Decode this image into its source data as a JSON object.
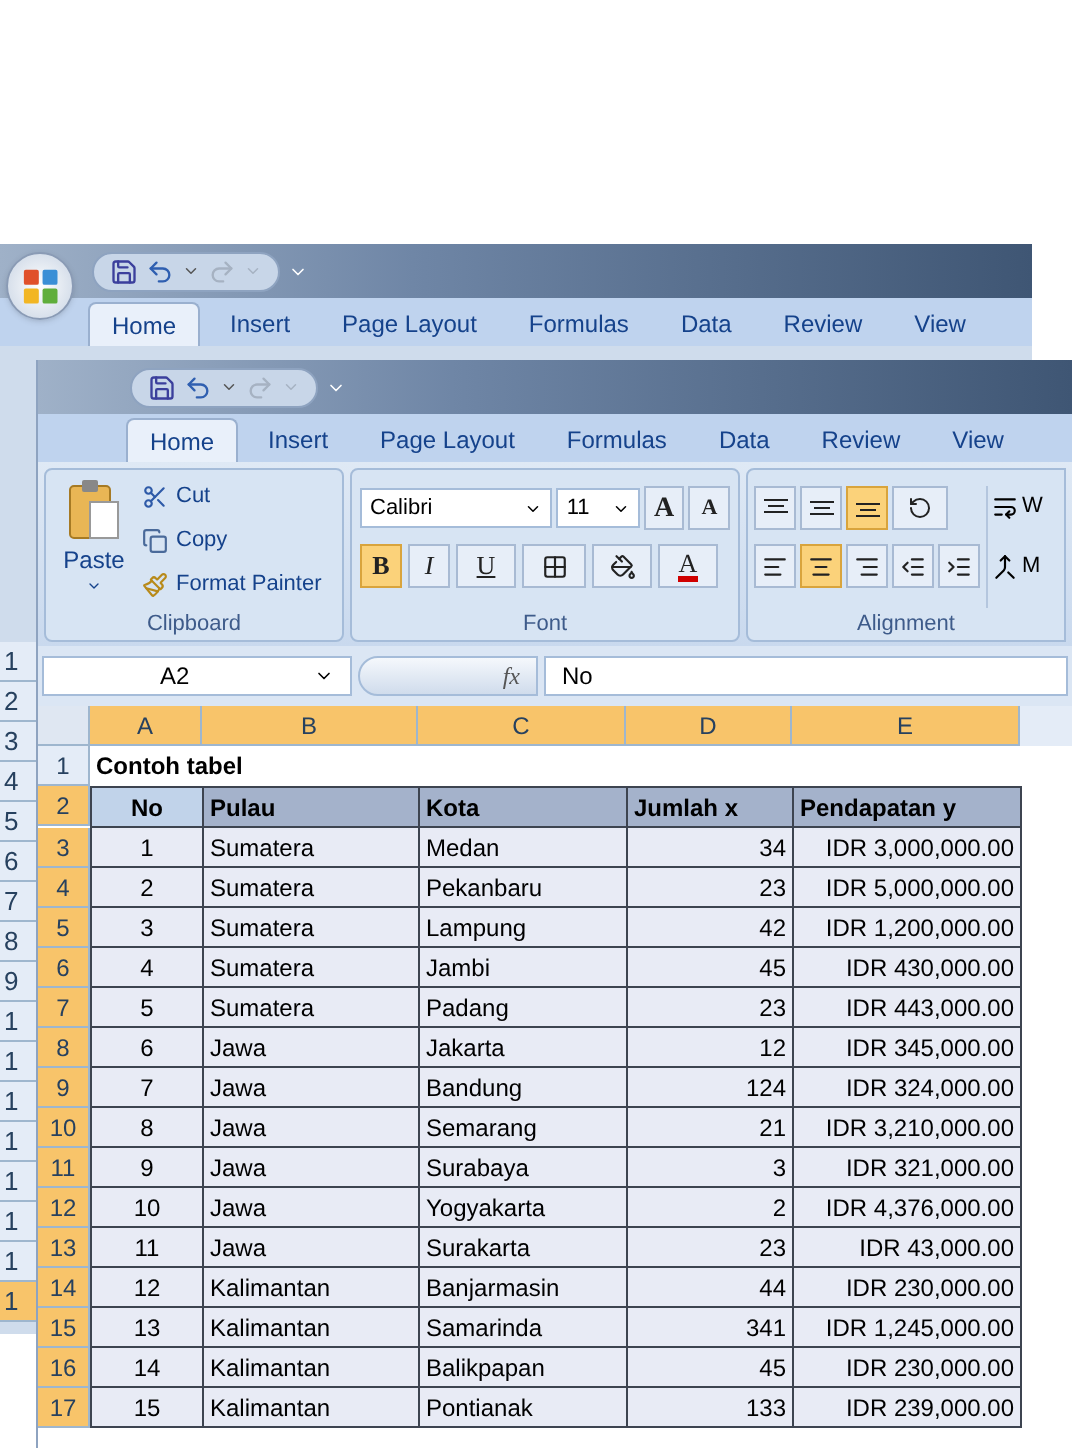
{
  "back_window": {
    "tabs": [
      {
        "label": "Home",
        "selected": true
      },
      {
        "label": "Insert",
        "selected": false
      },
      {
        "label": "Page Layout",
        "selected": false
      },
      {
        "label": "Formulas",
        "selected": false
      },
      {
        "label": "Data",
        "selected": false
      },
      {
        "label": "Review",
        "selected": false
      },
      {
        "label": "View",
        "selected": false
      }
    ],
    "row_numbers": [
      {
        "label": "1",
        "selected": false
      },
      {
        "label": "2",
        "selected": false
      },
      {
        "label": "3",
        "selected": false
      },
      {
        "label": "4",
        "selected": false
      },
      {
        "label": "5",
        "selected": false
      },
      {
        "label": "6",
        "selected": false
      },
      {
        "label": "7",
        "selected": false
      },
      {
        "label": "8",
        "selected": false
      },
      {
        "label": "9",
        "selected": false
      },
      {
        "label": "1",
        "selected": false
      },
      {
        "label": "1",
        "selected": false
      },
      {
        "label": "1",
        "selected": false
      },
      {
        "label": "1",
        "selected": false
      },
      {
        "label": "1",
        "selected": false
      },
      {
        "label": "1",
        "selected": false
      },
      {
        "label": "1",
        "selected": false
      },
      {
        "label": "1",
        "selected": true
      }
    ]
  },
  "window": {
    "tabs": [
      {
        "label": "Home",
        "selected": true
      },
      {
        "label": "Insert",
        "selected": false
      },
      {
        "label": "Page Layout",
        "selected": false
      },
      {
        "label": "Formulas",
        "selected": false
      },
      {
        "label": "Data",
        "selected": false
      },
      {
        "label": "Review",
        "selected": false
      },
      {
        "label": "View",
        "selected": false
      }
    ],
    "clipboard": {
      "paste": "Paste",
      "items": [
        {
          "kind": "cut",
          "label": "Cut"
        },
        {
          "kind": "copy",
          "label": "Copy"
        },
        {
          "kind": "painter",
          "label": "Format Painter"
        }
      ],
      "title": "Clipboard"
    },
    "font": {
      "name": "Calibri",
      "size": "11",
      "grow": "A",
      "shrink": "A",
      "bold": {
        "label": "B",
        "on": true
      },
      "italic": {
        "label": "I",
        "on": false
      },
      "underline": {
        "label": "U",
        "on": false
      },
      "color_letter": "A",
      "title": "Font"
    },
    "alignment": {
      "vertical": [
        {
          "selected": false
        },
        {
          "selected": false
        },
        {
          "selected": true
        }
      ],
      "horizontal": [
        {
          "selected": false
        },
        {
          "selected": true
        },
        {
          "selected": false
        }
      ],
      "wrap": "W",
      "merge": "M",
      "title": "Alignment"
    },
    "name_box": "A2",
    "fx": "fx",
    "formula": "No",
    "columns": [
      {
        "label": "A",
        "selected": true
      },
      {
        "label": "B",
        "selected": true
      },
      {
        "label": "C",
        "selected": true
      },
      {
        "label": "D",
        "selected": true
      },
      {
        "label": "E",
        "selected": true
      }
    ],
    "title_row": {
      "number": "1",
      "selected": false,
      "text": "Contoh tabel"
    },
    "header_row": {
      "number": "2",
      "selected": true,
      "cells": [
        "No",
        "Pulau",
        "Kota",
        "Jumlah x",
        "Pendapatan y"
      ]
    },
    "rows": [
      {
        "number": "3",
        "selected": true,
        "cells": [
          "1",
          "Sumatera",
          "Medan",
          "34",
          "IDR 3,000,000.00"
        ]
      },
      {
        "number": "4",
        "selected": true,
        "cells": [
          "2",
          "Sumatera",
          "Pekanbaru",
          "23",
          "IDR 5,000,000.00"
        ]
      },
      {
        "number": "5",
        "selected": true,
        "cells": [
          "3",
          "Sumatera",
          "Lampung",
          "42",
          "IDR 1,200,000.00"
        ]
      },
      {
        "number": "6",
        "selected": true,
        "cells": [
          "4",
          "Sumatera",
          "Jambi",
          "45",
          "IDR 430,000.00"
        ]
      },
      {
        "number": "7",
        "selected": true,
        "cells": [
          "5",
          "Sumatera",
          "Padang",
          "23",
          "IDR 443,000.00"
        ]
      },
      {
        "number": "8",
        "selected": true,
        "cells": [
          "6",
          "Jawa",
          "Jakarta",
          "12",
          "IDR 345,000.00"
        ]
      },
      {
        "number": "9",
        "selected": true,
        "cells": [
          "7",
          "Jawa",
          "Bandung",
          "124",
          "IDR 324,000.00"
        ]
      },
      {
        "number": "10",
        "selected": true,
        "cells": [
          "8",
          "Jawa",
          "Semarang",
          "21",
          "IDR 3,210,000.00"
        ]
      },
      {
        "number": "11",
        "selected": true,
        "cells": [
          "9",
          "Jawa",
          "Surabaya",
          "3",
          "IDR 321,000.00"
        ]
      },
      {
        "number": "12",
        "selected": true,
        "cells": [
          "10",
          "Jawa",
          "Yogyakarta",
          "2",
          "IDR 4,376,000.00"
        ]
      },
      {
        "number": "13",
        "selected": true,
        "cells": [
          "11",
          "Jawa",
          "Surakarta",
          "23",
          "IDR 43,000.00"
        ]
      },
      {
        "number": "14",
        "selected": true,
        "cells": [
          "12",
          "Kalimantan",
          "Banjarmasin",
          "44",
          "IDR 230,000.00"
        ]
      },
      {
        "number": "15",
        "selected": true,
        "cells": [
          "13",
          "Kalimantan",
          "Samarinda",
          "341",
          "IDR 1,245,000.00"
        ]
      },
      {
        "number": "16",
        "selected": true,
        "cells": [
          "14",
          "Kalimantan",
          "Balikpapan",
          "45",
          "IDR 230,000.00"
        ]
      },
      {
        "number": "17",
        "selected": true,
        "cells": [
          "15",
          "Kalimantan",
          "Pontianak",
          "133",
          "IDR 239,000.00"
        ]
      }
    ]
  }
}
